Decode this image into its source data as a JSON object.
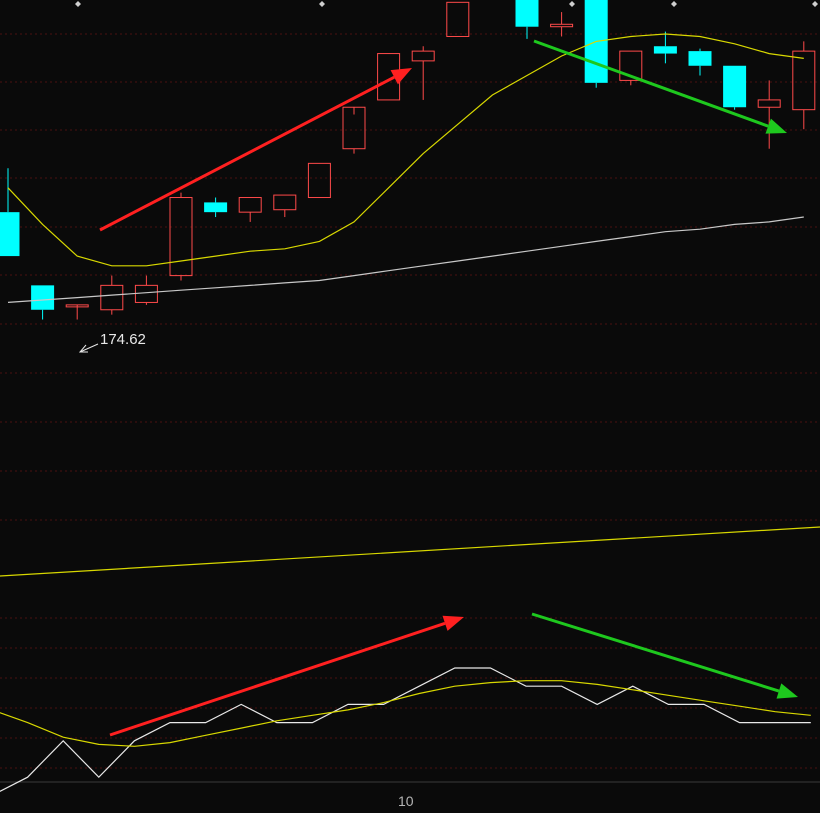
{
  "colors": {
    "background": "#0a0a0a",
    "grid": "#4a1010",
    "up": "#ff4a4a",
    "down": "#00ffff",
    "ma_short": "#d8d800",
    "ma_long": "#c8c8c8",
    "osc_fast": "#e8e8e8",
    "arrow_up": "#ff2020",
    "arrow_down": "#1ec81e"
  },
  "annotations": {
    "low_price_label": "174.62"
  },
  "x_axis": {
    "tick_label": "10"
  },
  "chart_data": [
    {
      "type": "candlestick",
      "candles": [
        {
          "o": 176.8,
          "h": 177.7,
          "l": 175.9,
          "c": 175.9
        },
        {
          "o": 175.3,
          "h": 175.3,
          "l": 174.6,
          "c": 174.8
        },
        {
          "o": 174.9,
          "h": 174.9,
          "l": 174.6,
          "c": 174.9
        },
        {
          "o": 174.8,
          "h": 175.5,
          "l": 174.7,
          "c": 175.3
        },
        {
          "o": 174.95,
          "h": 175.5,
          "l": 174.9,
          "c": 175.3
        },
        {
          "o": 175.5,
          "h": 177.2,
          "l": 175.4,
          "c": 177.1
        },
        {
          "o": 177.0,
          "h": 177.1,
          "l": 176.7,
          "c": 176.8
        },
        {
          "o": 176.8,
          "h": 177.1,
          "l": 176.6,
          "c": 177.1
        },
        {
          "o": 176.85,
          "h": 177.15,
          "l": 176.7,
          "c": 177.15
        },
        {
          "o": 177.1,
          "h": 177.8,
          "l": 177.1,
          "c": 177.8
        },
        {
          "o": 178.1,
          "h": 178.8,
          "l": 178.0,
          "c": 178.95
        },
        {
          "o": 179.1,
          "h": 180.05,
          "l": 179.1,
          "c": 180.05
        },
        {
          "o": 179.9,
          "h": 180.2,
          "l": 179.1,
          "c": 180.1
        },
        {
          "o": 180.4,
          "h": 181.1,
          "l": 180.4,
          "c": 181.1
        },
        {
          "o": 181.2,
          "h": 181.6,
          "l": 181.15,
          "c": 181.2
        },
        {
          "o": 181.2,
          "h": 181.3,
          "l": 180.35,
          "c": 180.6
        },
        {
          "o": 180.6,
          "h": 180.9,
          "l": 180.4,
          "c": 180.65
        },
        {
          "o": 181.2,
          "h": 181.2,
          "l": 179.35,
          "c": 179.45
        },
        {
          "o": 179.5,
          "h": 180.1,
          "l": 179.4,
          "c": 180.1
        },
        {
          "o": 180.2,
          "h": 180.5,
          "l": 179.85,
          "c": 180.05
        },
        {
          "o": 180.1,
          "h": 180.15,
          "l": 179.6,
          "c": 179.8
        },
        {
          "o": 179.8,
          "h": 179.8,
          "l": 178.9,
          "c": 178.95
        },
        {
          "o": 178.95,
          "h": 179.5,
          "l": 178.1,
          "c": 179.1
        },
        {
          "o": 178.9,
          "h": 180.3,
          "l": 178.5,
          "c": 180.1
        }
      ],
      "ma_short": [
        177.3,
        176.55,
        175.9,
        175.7,
        175.7,
        175.8,
        175.9,
        176.0,
        176.05,
        176.2,
        176.6,
        177.3,
        178.0,
        178.6,
        179.2,
        179.6,
        180.0,
        180.3,
        180.4,
        180.45,
        180.4,
        180.25,
        180.05,
        179.95
      ],
      "ma_long": [
        174.95,
        175.0,
        175.05,
        175.1,
        175.15,
        175.2,
        175.25,
        175.3,
        175.35,
        175.4,
        175.5,
        175.6,
        175.7,
        175.8,
        175.9,
        176.0,
        176.1,
        176.2,
        176.3,
        176.4,
        176.45,
        176.55,
        176.6,
        176.7
      ]
    },
    {
      "type": "line",
      "series": [
        {
          "values": [
            4,
            5,
            7,
            5,
            7,
            8,
            8,
            9,
            8,
            8,
            9,
            9,
            10,
            11,
            11,
            10,
            10,
            9,
            10,
            9,
            9,
            8,
            8,
            8
          ]
        },
        {
          "values": [
            8.7,
            8.0,
            7.2,
            6.8,
            6.7,
            6.9,
            7.3,
            7.7,
            8.1,
            8.4,
            8.7,
            9.1,
            9.6,
            10.0,
            10.2,
            10.3,
            10.3,
            10.1,
            9.8,
            9.5,
            9.2,
            8.9,
            8.6,
            8.4
          ]
        }
      ]
    }
  ]
}
